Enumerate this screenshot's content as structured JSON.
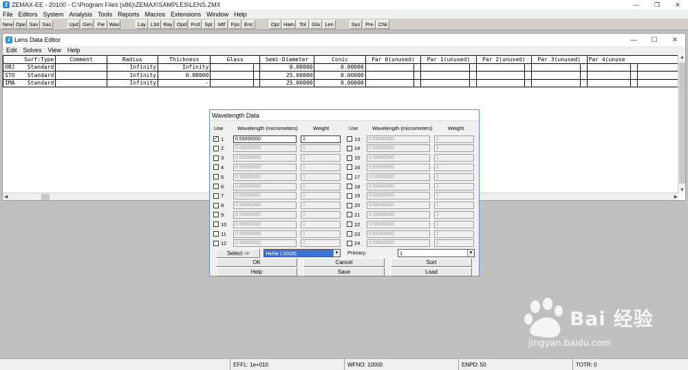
{
  "app": {
    "icon": "zemax-logo-icon",
    "title": "ZEMAX-EE - 20100 - C:\\Program Files (x86)\\ZEMAX\\SAMPLES\\LENS.ZMX",
    "window_controls": [
      "—",
      "❐",
      "✕"
    ]
  },
  "menu": [
    "File",
    "Editors",
    "System",
    "Analysis",
    "Tools",
    "Reports",
    "Macros",
    "Extensions",
    "Window",
    "Help"
  ],
  "toolbar": {
    "group1": [
      "New",
      "Ope",
      "Sav",
      "Sas"
    ],
    "group2": [
      "Upd",
      "Gen",
      "Fie",
      "Wav"
    ],
    "group3": [
      "Lay",
      "L3d",
      "Ray",
      "Opd",
      "Fcd",
      "Spt",
      "Mtf",
      "Fps",
      "Enc"
    ],
    "group4": [
      "Opt",
      "Ham",
      "Tol",
      "Gla",
      "Len"
    ],
    "group5": [
      "Sys",
      "Pre",
      "Chk"
    ]
  },
  "lde": {
    "title": "Lens Data Editor",
    "controls": [
      "—",
      "☐",
      "✕"
    ],
    "menu": [
      "Edit",
      "Solves",
      "View",
      "Help"
    ],
    "headers": [
      "Surf:Type",
      "Comment",
      "Radius",
      "Thickness",
      "Glass",
      "Semi-Diameter",
      "Conic",
      "Par 0(unused)",
      "Par 1(unused)",
      "Par 2(unused)",
      "Par 3(unused)",
      "Par 4(unuse"
    ],
    "rows": [
      {
        "surf": "OBJ",
        "type": "Standard",
        "comment": "",
        "radius": "Infinity",
        "thickness": "Infinity",
        "glass": "",
        "semi": "0.00000",
        "conic": "0.00000"
      },
      {
        "surf": "STO",
        "type": "Standard",
        "comment": "",
        "radius": "Infinity",
        "thickness": "0.00000",
        "glass": "",
        "semi": "25.00000",
        "conic": "0.00000"
      },
      {
        "surf": "IMA",
        "type": "Standard",
        "comment": "",
        "radius": "Infinity",
        "thickness": "-",
        "glass": "",
        "semi": "25.00000",
        "conic": "0.00000"
      }
    ]
  },
  "dialog": {
    "title": "Wavelength Data",
    "col_use": "Use",
    "col_wavelength": "Wavelength (micrometers)",
    "col_weight": "Weight",
    "left": [
      {
        "n": "1",
        "checked": true,
        "wl": "0.55000000",
        "wt": "1"
      },
      {
        "n": "2",
        "checked": false,
        "wl": "0.55000000",
        "wt": "1"
      },
      {
        "n": "3",
        "checked": false,
        "wl": "0.55000000",
        "wt": "1"
      },
      {
        "n": "4",
        "checked": false,
        "wl": "0.55000000",
        "wt": "1"
      },
      {
        "n": "5",
        "checked": false,
        "wl": "0.55000000",
        "wt": "1"
      },
      {
        "n": "6",
        "checked": false,
        "wl": "0.55000000",
        "wt": "1"
      },
      {
        "n": "7",
        "checked": false,
        "wl": "0.55000000",
        "wt": "1"
      },
      {
        "n": "8",
        "checked": false,
        "wl": "0.55000000",
        "wt": "1"
      },
      {
        "n": "9",
        "checked": false,
        "wl": "0.55000000",
        "wt": "1"
      },
      {
        "n": "10",
        "checked": false,
        "wl": "0.55000000",
        "wt": "1"
      },
      {
        "n": "11",
        "checked": false,
        "wl": "0.55000000",
        "wt": "1"
      },
      {
        "n": "12",
        "checked": false,
        "wl": "0.55000000",
        "wt": "1"
      }
    ],
    "right": [
      {
        "n": "13",
        "checked": false,
        "wl": "0.55000000",
        "wt": "1"
      },
      {
        "n": "14",
        "checked": false,
        "wl": "0.55000000",
        "wt": "1"
      },
      {
        "n": "15",
        "checked": false,
        "wl": "0.55000000",
        "wt": "1"
      },
      {
        "n": "16",
        "checked": false,
        "wl": "0.55000000",
        "wt": "1"
      },
      {
        "n": "17",
        "checked": false,
        "wl": "0.55000000",
        "wt": "1"
      },
      {
        "n": "18",
        "checked": false,
        "wl": "0.55000000",
        "wt": "1"
      },
      {
        "n": "19",
        "checked": false,
        "wl": "0.55000000",
        "wt": "1"
      },
      {
        "n": "20",
        "checked": false,
        "wl": "0.55000000",
        "wt": "1"
      },
      {
        "n": "21",
        "checked": false,
        "wl": "0.55000000",
        "wt": "1"
      },
      {
        "n": "22",
        "checked": false,
        "wl": "0.55000000",
        "wt": "1"
      },
      {
        "n": "23",
        "checked": false,
        "wl": "0.55000000",
        "wt": "1"
      },
      {
        "n": "24",
        "checked": false,
        "wl": "0.55000000",
        "wt": "1"
      }
    ],
    "select_label": "Select ->",
    "preset_value": "HeNe (.6328)",
    "primary_label": "Primary:",
    "primary_value": "1",
    "buttons": {
      "ok": "OK",
      "cancel": "Cancel",
      "sort": "Sort",
      "help": "Help",
      "save": "Save",
      "load": "Load"
    }
  },
  "status": {
    "effl": "EFFL: 1e+010",
    "wfno": "WFNO: 10000",
    "enpd": "ENPD: 50",
    "totr": "TOTR: 0"
  },
  "watermark": {
    "brand": "Bai 经验",
    "url": "jingyan.baidu.com"
  },
  "colors": {
    "dialog_border": "#5a8ed0",
    "selection": "#3b72d8",
    "workspace": "#c0c0c0"
  }
}
